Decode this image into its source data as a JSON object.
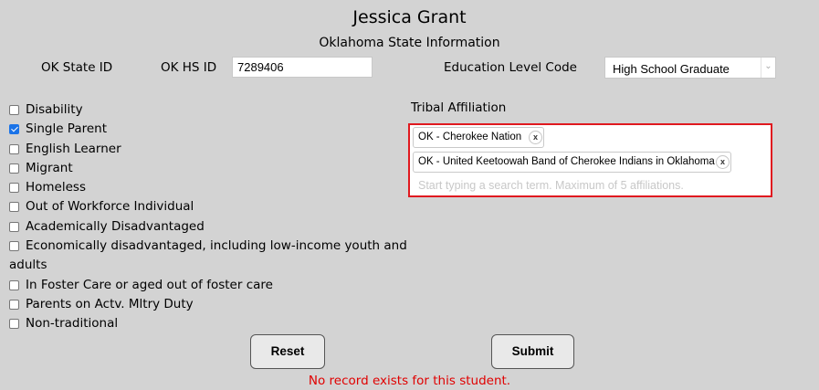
{
  "header": {
    "name": "Jessica Grant",
    "subtitle": "Oklahoma State Information"
  },
  "ids": {
    "state_id_label": "OK State ID",
    "hs_id_label": "OK HS ID",
    "hs_id_value": "7289406"
  },
  "education": {
    "label": "Education Level Code",
    "selected": "High School Graduate"
  },
  "checkboxes": [
    {
      "label": "Disability",
      "checked": false
    },
    {
      "label": "Single Parent",
      "checked": true
    },
    {
      "label": "English Learner",
      "checked": false
    },
    {
      "label": "Migrant",
      "checked": false
    },
    {
      "label": "Homeless",
      "checked": false
    },
    {
      "label": "Out of Workforce Individual",
      "checked": false
    },
    {
      "label": "Academically Disadvantaged",
      "checked": false
    },
    {
      "label": "Economically disadvantaged, including low-income youth and adults",
      "checked": false
    },
    {
      "label": "In Foster Care or aged out of foster care",
      "checked": false
    },
    {
      "label": "Parents on Actv. Mltry Duty",
      "checked": false
    },
    {
      "label": "Non-traditional",
      "checked": false
    }
  ],
  "tribal": {
    "label": "Tribal Affiliation",
    "tags": [
      "OK - Cherokee Nation",
      "OK - United Keetoowah Band of Cherokee Indians in Oklahoma"
    ],
    "remove_glyph": "x",
    "placeholder": "Start typing a search term. Maximum of 5 affiliations."
  },
  "buttons": {
    "reset": "Reset",
    "submit": "Submit"
  },
  "message": "No record exists for this student.",
  "colors": {
    "background": "#d3d3d3",
    "highlight_border": "#e0191f",
    "error_text": "#e00000",
    "checkbox_checked": "#1a73e8"
  }
}
